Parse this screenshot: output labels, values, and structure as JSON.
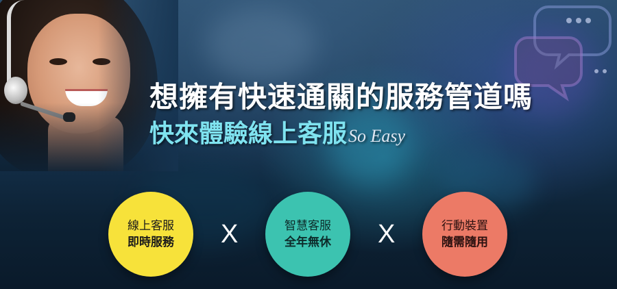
{
  "headline": {
    "line1": "想擁有快速通關的服務管道嗎",
    "line2_cn": "快來體驗線上客服",
    "line2_en": "So Easy"
  },
  "features": [
    {
      "title": "線上客服",
      "subtitle": "即時服務",
      "color": "#f7e23a"
    },
    {
      "title": "智慧客服",
      "subtitle": "全年無休",
      "color": "#3cc3b0"
    },
    {
      "title": "行動裝置",
      "subtitle": "隨需隨用",
      "color": "#ec7a66"
    }
  ],
  "separators": [
    "X",
    "X"
  ],
  "colors": {
    "background": "#163451",
    "headline": "#ffffff",
    "subline_accent": "#7fe3f0"
  },
  "icons": {
    "photo": "customer-service-agent-with-headset",
    "decoration": "speech-bubble-outlines"
  }
}
